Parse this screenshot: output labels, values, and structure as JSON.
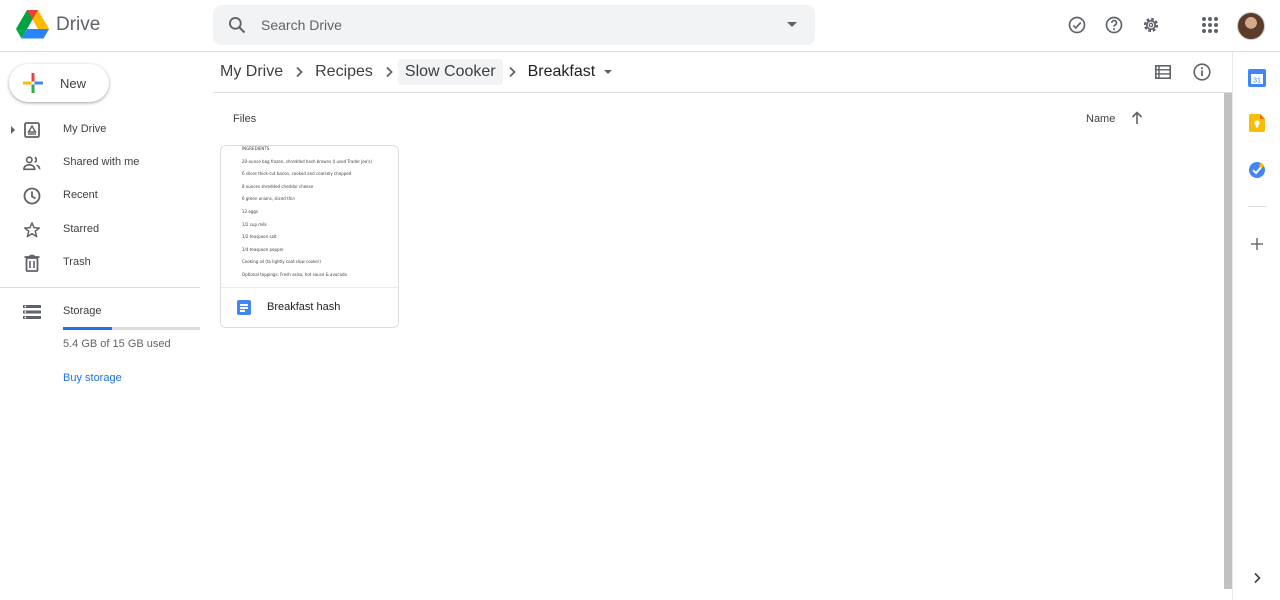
{
  "header": {
    "app_name": "Drive",
    "search_placeholder": "Search Drive",
    "icons": [
      "drive-logo",
      "search-icon",
      "search-options-icon",
      "offline-ready-icon",
      "help-icon",
      "settings-icon",
      "apps-grid-icon",
      "account-avatar"
    ]
  },
  "sidebar": {
    "new_label": "New",
    "items": [
      {
        "label": "My Drive",
        "icon": "my-drive-icon"
      },
      {
        "label": "Shared with me",
        "icon": "shared-icon"
      },
      {
        "label": "Recent",
        "icon": "recent-clock-icon"
      },
      {
        "label": "Starred",
        "icon": "star-icon"
      },
      {
        "label": "Trash",
        "icon": "trash-icon"
      }
    ],
    "storage": {
      "label": "Storage",
      "used_text": "5.4 GB of 15 GB used",
      "used_fraction": 0.36,
      "buy_label": "Buy storage"
    }
  },
  "breadcrumb": {
    "items": [
      "My Drive",
      "Recipes",
      "Slow Cooker",
      "Breakfast"
    ]
  },
  "content": {
    "section_label": "Files",
    "sort_label": "Name",
    "sort_direction": "ascending",
    "files": [
      {
        "name": "Breakfast hash",
        "type": "document",
        "preview_lines": [
          "INGREDIENTS",
          "20-ounce bag frozen, shredded hash browns (I used Trader Joe's)",
          "6 slices thick-cut bacon, cooked and coarsely chopped",
          "8 ounces shredded cheddar cheese",
          "6 green onions, sliced thin",
          "12 eggs",
          "1/2 cup milk",
          "1/2 teaspoon salt",
          "1/4 teaspoon pepper",
          "Cooking oil (to lightly coat slow cooker)",
          "Optional toppings: Fresh salsa, hot sauce & avocado"
        ]
      }
    ]
  },
  "side_panel": {
    "icons": [
      "calendar-icon",
      "keep-icon",
      "tasks-icon",
      "get-addons-icon",
      "expand-panel-icon"
    ],
    "calendar_day": "31"
  },
  "colors": {
    "accent_blue": "#1a73e8",
    "doc_blue": "#4285f4",
    "keep_yellow": "#fbbc04",
    "border": "#dadce0"
  }
}
